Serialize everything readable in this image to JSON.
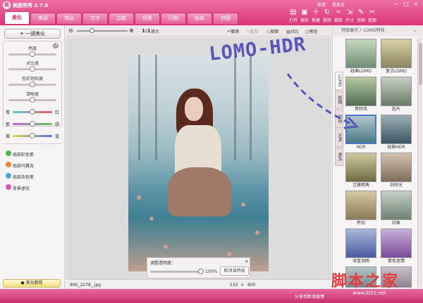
{
  "app": {
    "title": "美图秀秀 2.7.0",
    "logo_glyph": "美"
  },
  "top_links": [
    "菜单",
    "提意见"
  ],
  "window_controls": [
    "－",
    "□",
    "×"
  ],
  "nav_tabs": [
    "美化",
    "美容",
    "饰品",
    "文字",
    "边框",
    "场景",
    "闪图",
    "娃娃",
    "拼图"
  ],
  "toolbar": [
    "打开",
    "保存",
    "新建",
    "旋转",
    "裁剪",
    "尺寸",
    "涂鸦",
    "抠图"
  ],
  "left_panel": {
    "one_click": "一键美化",
    "sliders": [
      "亮度",
      "对比度",
      "色彩饱和度",
      "清晰度"
    ],
    "color_sliders": [
      [
        "青",
        "红"
      ],
      [
        "紫",
        "绿"
      ],
      [
        "黄",
        "蓝"
      ]
    ],
    "brushes": [
      "局部彩色笔",
      "局部马赛克",
      "局部去色笔",
      "背景虚化"
    ],
    "tutorial": "美化教程"
  },
  "canvas_toolbar": {
    "zoom": "1:1",
    "orig": "原大",
    "undo": "撤销",
    "redo": "重做",
    "original": "原图",
    "compare": "对比",
    "preview": "预览"
  },
  "opacity_panel": {
    "title": "调整透明度：",
    "value": "100%",
    "cancel": "取消该特效",
    "close": "×"
  },
  "status": {
    "filename": "IMG_2278_.jpg",
    "width": "533",
    "times": "×",
    "height": "800"
  },
  "right_panel": {
    "breadcrumb": "特效展示 〉LOMO特效",
    "side_tabs": [
      "LOMO",
      "影楼",
      "时尚",
      "艺术",
      "更多"
    ],
    "thumbs": [
      "经典LOMO",
      "复古LOMO",
      "哥特风",
      "胶片",
      "HDR",
      "经典HDR",
      "泛黄暗角",
      "旧时光",
      "怀旧",
      "印象",
      "深蓝泪雨",
      "紫色迷情",
      "",
      ""
    ]
  },
  "annotation": "LOMO-HDR",
  "watermark": {
    "text": "脚本之家",
    "url": "www.jb51.net"
  },
  "bottom": {
    "weibo": "分享到新浪微博"
  }
}
